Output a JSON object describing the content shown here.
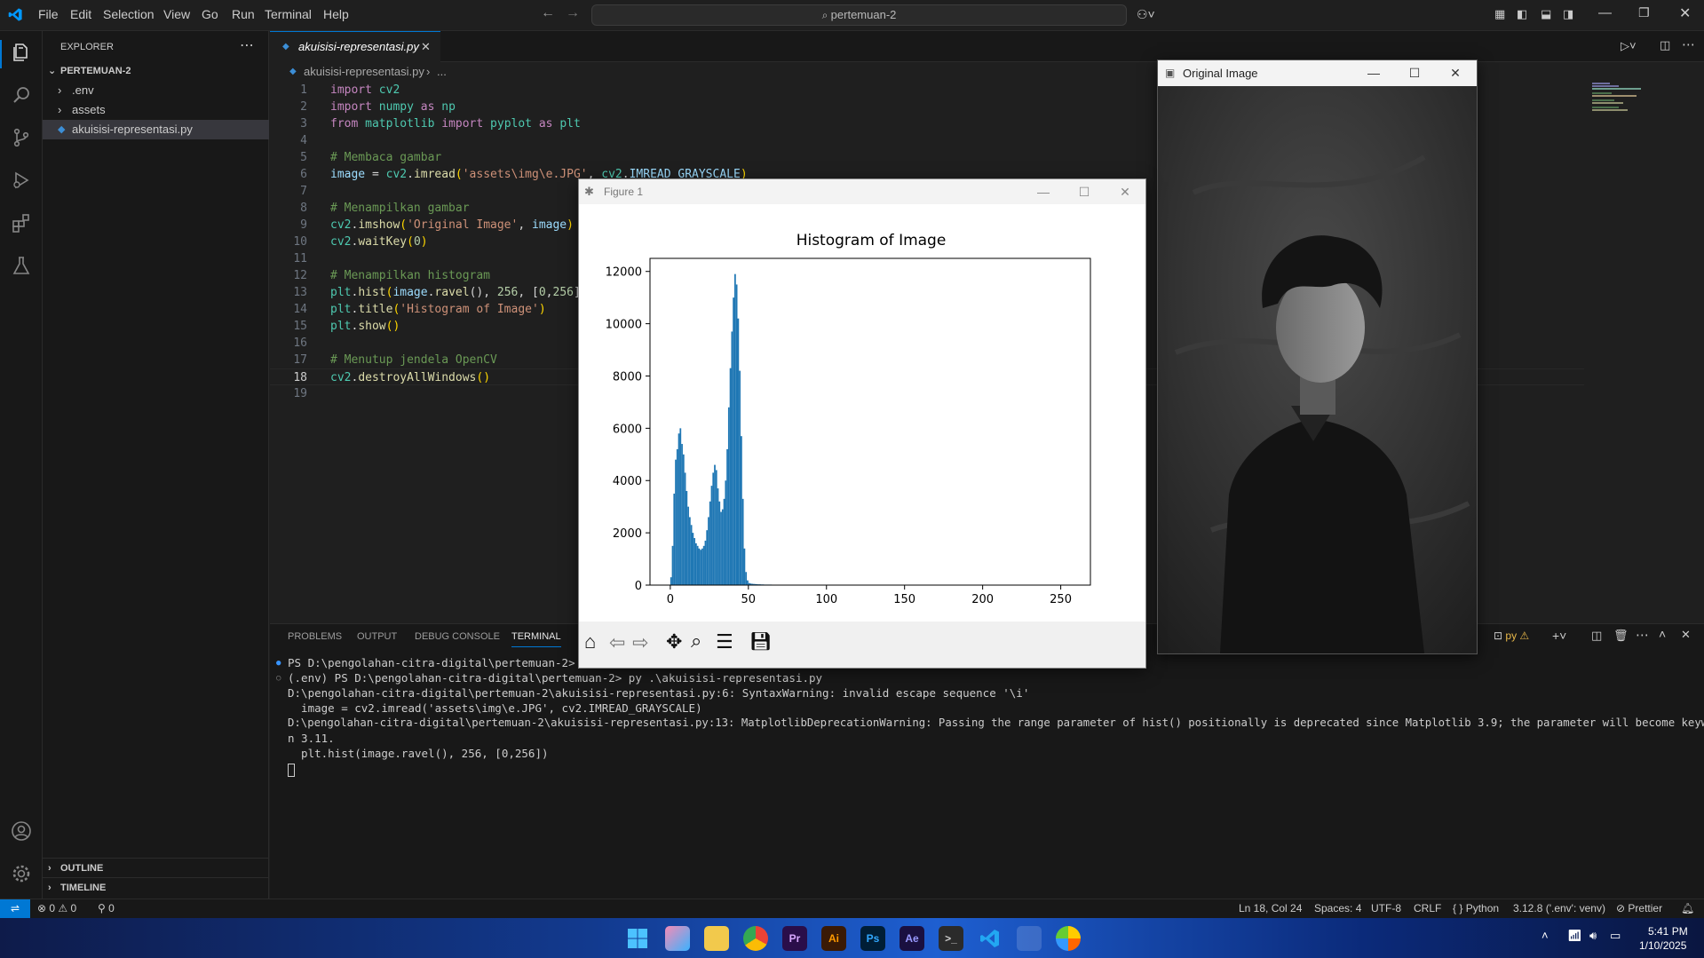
{
  "menu": [
    "File",
    "Edit",
    "Selection",
    "View",
    "Go",
    "Run",
    "Terminal",
    "Help"
  ],
  "search": {
    "text": "pertemuan-2"
  },
  "explorer": {
    "title": "EXPLORER",
    "root": "PERTEMUAN-2",
    "items": [
      ".env",
      "assets",
      "akuisisi-representasi.py"
    ],
    "outline": "OUTLINE",
    "timeline": "TIMELINE"
  },
  "editor": {
    "tab": "akuisisi-representasi.py",
    "breadcrumb_file": "akuisisi-representasi.py",
    "breadcrumb_rest": "...",
    "current_line": 18
  },
  "code": [
    "import cv2",
    "import numpy as np",
    "from matplotlib import pyplot as plt",
    "",
    "# Membaca gambar",
    "image = cv2.imread('assets\\img\\e.JPG', cv2.IMREAD_GRAYSCALE)",
    "",
    "# Menampilkan gambar",
    "cv2.imshow('Original Image', image)",
    "cv2.waitKey(0)",
    "",
    "# Menampilkan histogram",
    "plt.hist(image.ravel(), 256, [0,256])",
    "plt.title('Histogram of Image')",
    "plt.show()",
    "",
    "# Menutup jendela OpenCV",
    "cv2.destroyAllWindows()",
    ""
  ],
  "panel": {
    "tabs": [
      "PROBLEMS",
      "OUTPUT",
      "DEBUG CONSOLE",
      "TERMINAL"
    ],
    "active": "TERMINAL"
  },
  "terminal": {
    "lines": [
      "PS D:\\pengolahan-citra-digital\\pertemuan-2> .env",
      "(.env) PS D:\\pengolahan-citra-digital\\pertemuan-2> py .\\akuisisi-representasi.py",
      "D:\\pengolahan-citra-digital\\pertemuan-2\\akuisisi-representasi.py:6: SyntaxWarning: invalid escape sequence '\\i'",
      "  image = cv2.imread('assets\\img\\e.JPG', cv2.IMREAD_GRAYSCALE)",
      "D:\\pengolahan-citra-digital\\pertemuan-2\\akuisisi-representasi.py:13: MatplotlibDeprecationWarning: Passing the range parameter of hist() positionally is deprecated since Matplotlib 3.9; the parameter will become keyword-only i",
      "n 3.11.",
      "  plt.hist(image.ravel(), 256, [0,256])"
    ],
    "python_label": "py"
  },
  "status": {
    "errors": "0",
    "warnings": "0",
    "ports": "0",
    "position": "Ln 18, Col 24",
    "spaces": "Spaces: 4",
    "encoding": "UTF-8",
    "eol": "CRLF",
    "language": "Python",
    "interpreter": "3.12.8 ('.env': venv)",
    "formatter": "Prettier"
  },
  "taskbar": {
    "time": "5:41 PM",
    "date": "1/10/2025"
  },
  "figure_window": {
    "title": "Figure 1"
  },
  "image_window": {
    "title": "Original Image"
  },
  "chart_data": {
    "type": "bar",
    "title": "Histogram of Image",
    "xlabel": "",
    "ylabel": "",
    "xlim": [
      -13,
      269
    ],
    "ylim": [
      0,
      12500
    ],
    "xticks": [
      0,
      50,
      100,
      150,
      200,
      250
    ],
    "yticks": [
      0,
      2000,
      4000,
      6000,
      8000,
      10000,
      12000
    ],
    "bar_color": "#1f77b4",
    "x": [
      0,
      1,
      2,
      3,
      4,
      5,
      6,
      7,
      8,
      9,
      10,
      11,
      12,
      13,
      14,
      15,
      16,
      17,
      18,
      19,
      20,
      21,
      22,
      23,
      24,
      25,
      26,
      27,
      28,
      29,
      30,
      31,
      32,
      33,
      34,
      35,
      36,
      37,
      38,
      39,
      40,
      41,
      42,
      43,
      44,
      45,
      46,
      47,
      48,
      49,
      50,
      51,
      52,
      53,
      54,
      55,
      56,
      58,
      60,
      65,
      70,
      80,
      90,
      100,
      110,
      120,
      130,
      140,
      150
    ],
    "values": [
      300,
      1500,
      3500,
      4800,
      5200,
      5800,
      6000,
      5400,
      5000,
      4300,
      3600,
      3000,
      2600,
      2300,
      2000,
      1800,
      1600,
      1500,
      1400,
      1350,
      1400,
      1500,
      1700,
      2100,
      2600,
      3200,
      3800,
      4300,
      4600,
      4400,
      3700,
      3200,
      2800,
      2900,
      3300,
      4000,
      5200,
      6800,
      8300,
      9700,
      11000,
      11900,
      11500,
      10200,
      8200,
      5700,
      3300,
      1400,
      500,
      180,
      80,
      60,
      50,
      45,
      40,
      35,
      30,
      25,
      20,
      15,
      14,
      12,
      10,
      9,
      8,
      7,
      5,
      3,
      1
    ]
  }
}
